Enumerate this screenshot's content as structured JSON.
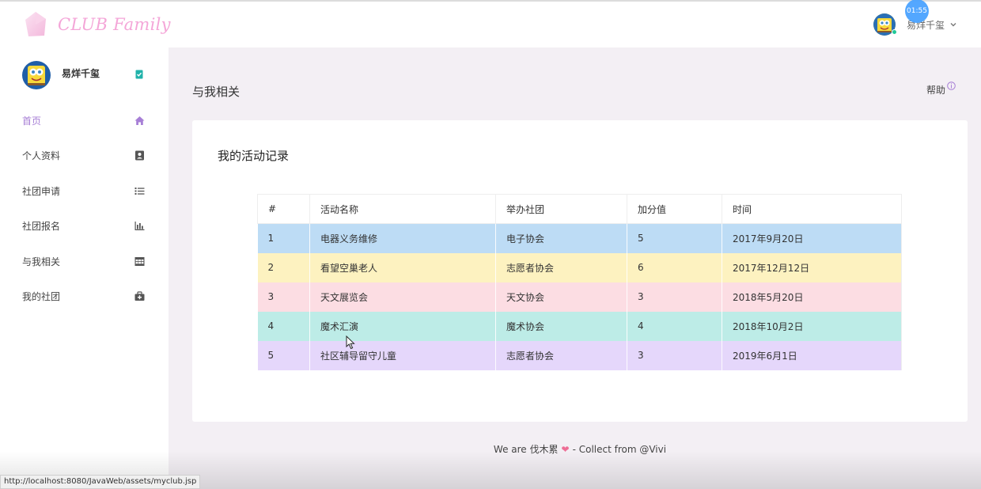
{
  "brand": {
    "name": "CLUB Family"
  },
  "header": {
    "user_name": "易烊千玺",
    "time_badge": "01:55"
  },
  "sidebar": {
    "profile_name": "易烊千玺",
    "items": [
      {
        "label": "首页",
        "icon": "home-icon",
        "active": true
      },
      {
        "label": "个人资料",
        "icon": "contact-card-icon",
        "active": false
      },
      {
        "label": "社团申请",
        "icon": "list-icon",
        "active": false
      },
      {
        "label": "社团报名",
        "icon": "bar-chart-icon",
        "active": false
      },
      {
        "label": "与我相关",
        "icon": "table-icon",
        "active": false
      },
      {
        "label": "我的社团",
        "icon": "medkit-icon",
        "active": false
      }
    ]
  },
  "main": {
    "page_title": "与我相关",
    "help_label": "帮助",
    "card_title": "我的活动记录",
    "table": {
      "headers": [
        "#",
        "活动名称",
        "举办社团",
        "加分值",
        "时间"
      ],
      "rows": [
        {
          "cells": [
            "1",
            "电器义务维修",
            "电子协会",
            "5",
            "2017年9月20日"
          ],
          "color": "#bddcf5"
        },
        {
          "cells": [
            "2",
            "看望空巢老人",
            "志愿者协会",
            "6",
            "2017年12月12日"
          ],
          "color": "#fdf2c0"
        },
        {
          "cells": [
            "3",
            "天文展览会",
            "天文协会",
            "3",
            "2018年5月20日"
          ],
          "color": "#fcdde3"
        },
        {
          "cells": [
            "4",
            "魔术汇演",
            "魔术协会",
            "4",
            "2018年10月2日"
          ],
          "color": "#bdece7"
        },
        {
          "cells": [
            "5",
            "社区辅导留守儿童",
            "志愿者协会",
            "3",
            "2019年6月1日"
          ],
          "color": "#e5d7fb"
        }
      ]
    }
  },
  "footer": {
    "prefix": "We are 伐木累",
    "suffix": "- Collect from @Vivi"
  },
  "status_bar": {
    "url": "http://localhost:8080/JavaWeb/assets/myclub.jsp"
  },
  "colors": {
    "accent": "#a77fd6",
    "brand_text": "#f4a6d8",
    "page_bg": "#f3eff4",
    "heart": "#ee6d95",
    "online": "#20c997",
    "verified": "#20b2aa"
  }
}
